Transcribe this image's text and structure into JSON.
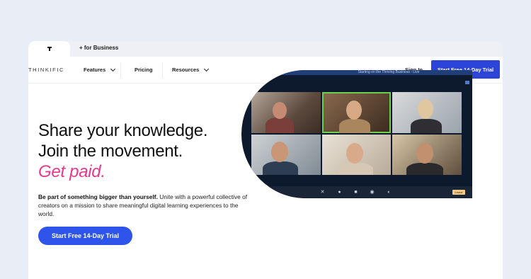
{
  "tabs": {
    "business_label": "+ for Business"
  },
  "nav": {
    "brand": "THINKIFIC",
    "features": "Features",
    "pricing": "Pricing",
    "resources": "Resources",
    "sign_in": "Sign In",
    "cta": "Start Free 14-Day Trial"
  },
  "hero": {
    "line1": "Share your knowledge.",
    "line2": "Join the movement.",
    "line3": "Get paid.",
    "desc_bold": "Be part of something bigger than yourself.",
    "desc_rest": " Unite with a powerful collective of creators on a mission to share meaningful digital learning experiences to the world.",
    "cta": "Start Free 14-Day Trial"
  },
  "video": {
    "title": "Starting on the Thriving Business - Live",
    "leave_label": "Leave",
    "participants": [
      "participant-1",
      "participant-2",
      "participant-3",
      "participant-4",
      "participant-5",
      "participant-6"
    ]
  },
  "colors": {
    "accent": "#2c45d8",
    "pink": "#e8388f",
    "hero_button": "#2f54eb"
  }
}
